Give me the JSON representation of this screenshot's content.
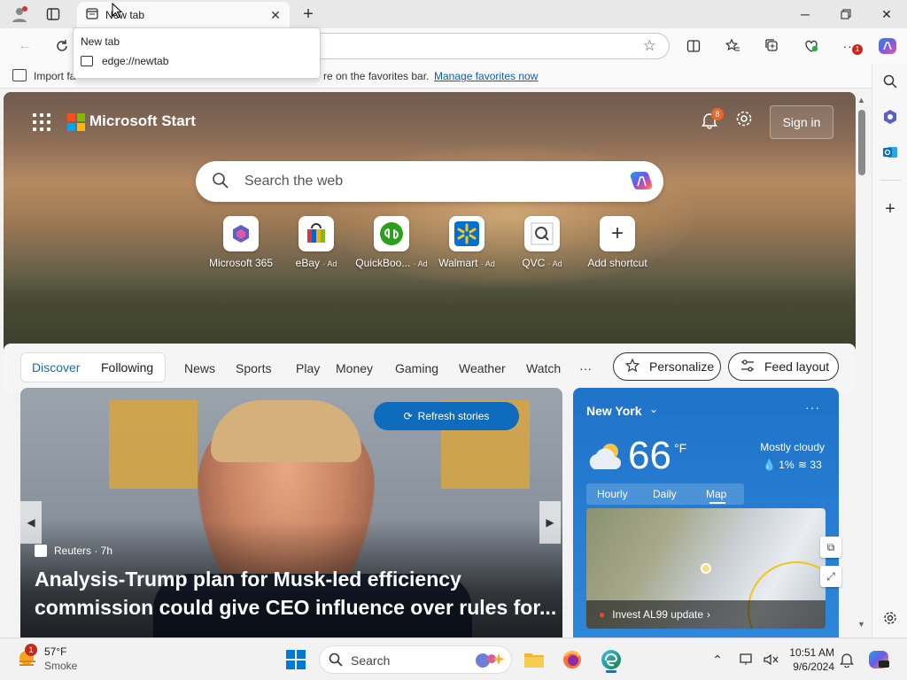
{
  "browser": {
    "tab": {
      "title": "New tab"
    },
    "tooltip": {
      "title": "New tab",
      "url": "edge://newtab"
    },
    "favorites_bar": {
      "text_start": "Import fa",
      "text_end": "re on the favorites bar.",
      "link": "Manage favorites now"
    },
    "toolbar_badge": "1"
  },
  "newtab": {
    "brand": "Microsoft Start",
    "notifications_count": "8",
    "sign_in": "Sign in",
    "search_placeholder": "Search the web",
    "shortcuts": [
      {
        "label": "Microsoft 365",
        "ad": ""
      },
      {
        "label": "eBay",
        "ad": "· Ad"
      },
      {
        "label": "QuickBoo...",
        "ad": "· Ad"
      },
      {
        "label": "Walmart",
        "ad": "· Ad"
      },
      {
        "label": "QVC",
        "ad": "· Ad"
      },
      {
        "label": "Add shortcut",
        "ad": ""
      }
    ],
    "feed_tabs": {
      "discover": "Discover",
      "following": "Following"
    },
    "nav": [
      "News",
      "Sports",
      "Play",
      "Money",
      "Gaming",
      "Weather",
      "Watch",
      "···"
    ],
    "personalize": "Personalize",
    "feed_layout": "Feed layout",
    "news": {
      "refresh": "Refresh stories",
      "source": "Reuters · 7h",
      "headline": "Analysis-Trump plan for Musk-led efficiency commission could give CEO influence over rules for..."
    },
    "weather": {
      "location": "New York",
      "more": "···",
      "temp": "66",
      "unit": "°F",
      "condition": "Mostly cloudy",
      "precip": "1%",
      "wind": "33",
      "tabs": [
        "Hourly",
        "Daily",
        "Map"
      ],
      "map_label": "Invest AL99 update"
    }
  },
  "taskbar": {
    "weather_temp": "57°F",
    "weather_desc": "Smoke",
    "weather_badge": "1",
    "search_placeholder": "Search",
    "time": "10:51 AM",
    "date": "9/6/2024"
  },
  "colors": {
    "accent": "#0f6cbd",
    "weather_card": "#2b7fd2",
    "ms_red": "#f25022",
    "ms_green": "#7fba00",
    "ms_blue": "#00a4ef",
    "ms_yellow": "#ffb900"
  }
}
